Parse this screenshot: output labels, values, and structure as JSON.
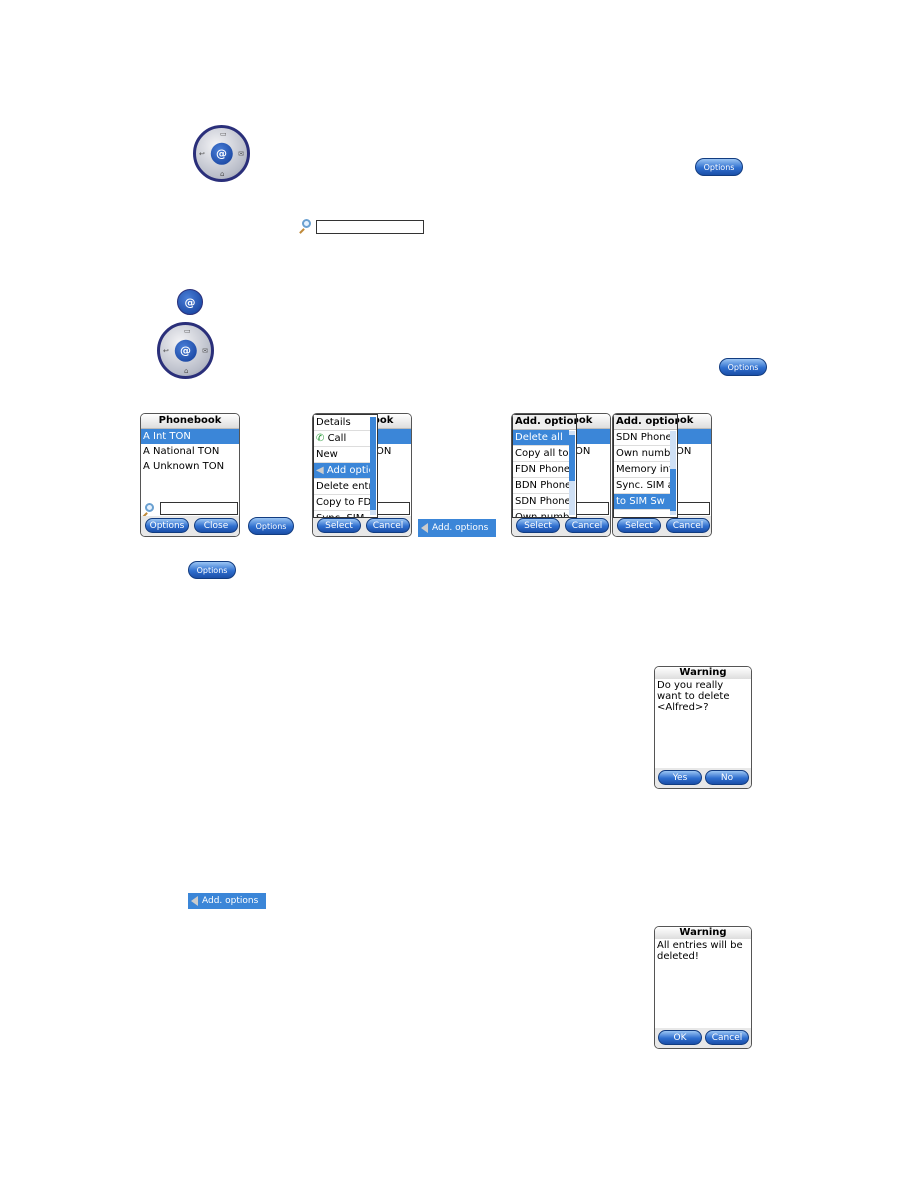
{
  "navpad_icon": "navigation-key-at-icon",
  "at_symbol": "@",
  "options_label": "Options",
  "add_options_label": "Add. options",
  "screens": [
    {
      "title": "Phonebook",
      "rows": [
        {
          "t": "A Int TON",
          "sel": true
        },
        {
          "t": "A National TON"
        },
        {
          "t": "A Unknown TON"
        }
      ],
      "search": true,
      "buttons": [
        "Options",
        "Close"
      ]
    },
    {
      "title": "Phonebook",
      "rows": [
        {
          "t": "",
          "sel": true
        },
        {
          "t": "A National TON"
        },
        {
          "t": ""
        }
      ],
      "search": true,
      "buttons": [
        "Select",
        "Cancel"
      ],
      "menu": {
        "items": [
          {
            "t": "Details"
          },
          {
            "t": "Call",
            "icon": "phone-icon"
          },
          {
            "t": "New"
          },
          {
            "t": "Add options",
            "sel": true,
            "icon": "left-arrow-icon"
          },
          {
            "t": "Delete entry"
          },
          {
            "t": "Copy to FDN"
          },
          {
            "t": "Sync. SIM"
          }
        ],
        "thumb": [
          0,
          0.95
        ]
      }
    },
    {
      "title": "Phonebook",
      "rows": [
        {
          "t": "",
          "sel": true
        },
        {
          "t": "A National TON"
        },
        {
          "t": ""
        }
      ],
      "search": true,
      "buttons": [
        "Select",
        "Cancel"
      ],
      "menu": {
        "title": "Add. options",
        "items": [
          {
            "t": "Delete all",
            "sel": true
          },
          {
            "t": "Copy all to FDN"
          },
          {
            "t": "FDN Phonebook"
          },
          {
            "t": "BDN Phonebook"
          },
          {
            "t": "SDN Phonebook"
          },
          {
            "t": "Own number"
          }
        ],
        "thumb": [
          0.05,
          0.6
        ]
      }
    },
    {
      "title": "Phonebook",
      "rows": [
        {
          "t": "",
          "sel": true
        },
        {
          "t": "A National TON"
        },
        {
          "t": ""
        }
      ],
      "search": true,
      "buttons": [
        "Select",
        "Cancel"
      ],
      "menu": {
        "title": "Add. options",
        "items": [
          {
            "t": "SDN Phonebook"
          },
          {
            "t": "Own number"
          },
          {
            "t": "Memory info"
          },
          {
            "t": "Sync. SIM all"
          },
          {
            "t": "to SIM      Sw",
            "sel": true
          }
        ],
        "thumb": [
          0.45,
          0.95
        ]
      }
    }
  ],
  "warnings": [
    {
      "title": "Warning",
      "message": "Do you really want to delete <Alfred>?",
      "buttons": [
        "Yes",
        "No"
      ]
    },
    {
      "title": "Warning",
      "message": "All entries will be deleted!",
      "buttons": [
        "OK",
        "Cancel"
      ]
    }
  ]
}
